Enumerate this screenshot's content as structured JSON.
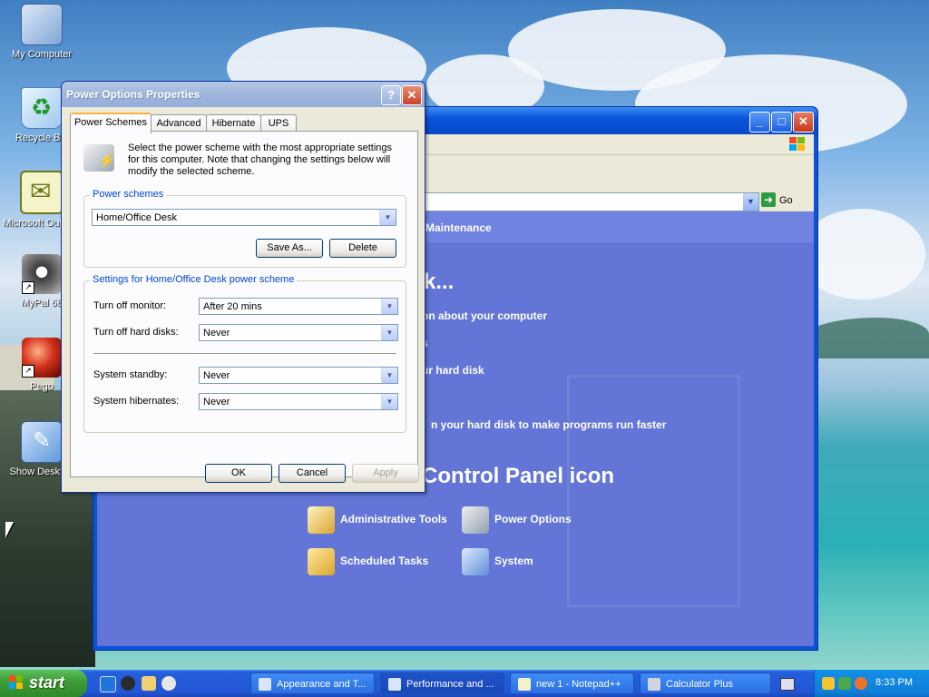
{
  "desktop": {
    "icons": [
      {
        "label": "My Computer"
      },
      {
        "label": "Recycle Bin"
      },
      {
        "label": "Microsoft Outlook"
      },
      {
        "label": "MyPal 68"
      },
      {
        "label": "Pego"
      },
      {
        "label": "Show Desktop"
      }
    ]
  },
  "control_panel": {
    "go_label": "Go",
    "category_band": "Maintenance",
    "pick_a_task": "k...",
    "tasks": [
      "on about your computer",
      "s",
      "ur hard disk",
      "n your hard disk to make programs run faster"
    ],
    "pick_icon_heading": "Control Panel icon",
    "icons": [
      {
        "label": "Administrative Tools"
      },
      {
        "label": "Power Options"
      },
      {
        "label": "Scheduled Tasks"
      },
      {
        "label": "System"
      }
    ]
  },
  "dialog": {
    "title": "Power Options Properties",
    "tabs": [
      "Power Schemes",
      "Advanced",
      "Hibernate",
      "UPS"
    ],
    "active_tab": "Power Schemes",
    "intro": "Select the power scheme with the most appropriate settings for this computer. Note that changing the settings below will modify the selected scheme.",
    "schemes_group_label": "Power schemes",
    "selected_scheme": "Home/Office Desk",
    "save_as_label": "Save As...",
    "delete_label": "Delete",
    "settings_group_label": "Settings for Home/Office Desk power scheme",
    "settings": [
      {
        "label": "Turn off monitor:",
        "value": "After 20 mins"
      },
      {
        "label": "Turn off hard disks:",
        "value": "Never"
      },
      {
        "label": "System standby:",
        "value": "Never"
      },
      {
        "label": "System hibernates:",
        "value": "Never"
      }
    ],
    "ok_label": "OK",
    "cancel_label": "Cancel",
    "apply_label": "Apply"
  },
  "taskbar": {
    "start_label": "start",
    "items": [
      {
        "label": "Appearance and T..."
      },
      {
        "label": "Performance and ..."
      },
      {
        "label": "new 1 - Notepad++"
      },
      {
        "label": "Calculator Plus"
      }
    ],
    "clock": "8:33 PM"
  }
}
